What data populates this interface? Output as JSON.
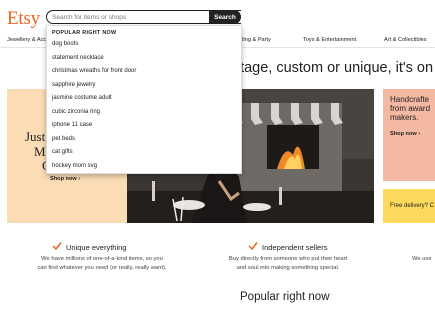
{
  "header": {
    "logo": "Etsy",
    "search_placeholder": "Search for items or shops",
    "search_button": "Search"
  },
  "nav": {
    "categories": [
      "Jewellery & Acc",
      "Wedding & Party",
      "Toys & Entertainment",
      "Art & Collectibles"
    ]
  },
  "hero": {
    "headline": "ntage, custom or unique, it's on Et",
    "left_panel": {
      "line1": "Just I",
      "line2": "Mi",
      "line3": "C",
      "shop_now": "Shop now"
    },
    "right_panel": {
      "text": "Handcrafte from award makers.",
      "line1": "Handcrafte",
      "line2": "from award",
      "line3": "makers.",
      "shop_now": "Shop now"
    },
    "promo": {
      "text": "Free delivery? C"
    }
  },
  "value_props": [
    {
      "title": "Unique everything",
      "body_line1": "We have millions of one-of-a-kind items, so you",
      "body_line2": "can find whatever you need (or really, really want)."
    },
    {
      "title": "Independent sellers",
      "body_line1": "Buy directly from someone who put their heart",
      "body_line2": "and soul into making something special."
    },
    {
      "title": "",
      "body_line1": "We use"
    }
  ],
  "section": {
    "popular_title": "Popular right now"
  },
  "dropdown": {
    "heading": "POPULAR RIGHT NOW",
    "items": [
      "dog boots",
      "statement necklace",
      "christmas wreaths for front door",
      "sapphire jewelry",
      "jasmine costume adult",
      "cubic zirconia ring",
      "iphone 11 case",
      "pet beds",
      "cat gifts",
      "hockey mom svg"
    ]
  },
  "colors": {
    "brand": "#f1641e",
    "peach_panel": "#fbdcb5",
    "pink_panel": "#f4b9a2",
    "yellow_panel": "#fdd95c",
    "check": "#f1641e"
  }
}
